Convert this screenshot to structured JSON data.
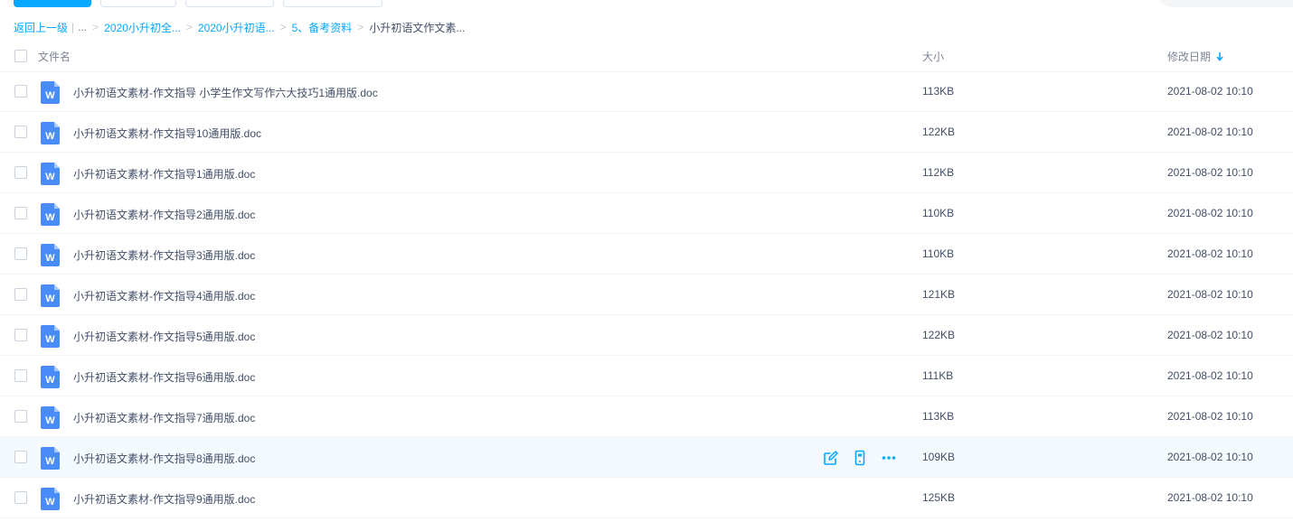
{
  "colors": {
    "accent": "#06a7ff",
    "doc_icon": "#4a8cf7",
    "text": "#424e67",
    "muted": "#7d8596",
    "row_hover": "#f5fafe"
  },
  "breadcrumb": {
    "back": "返回上一级",
    "separator": "|",
    "ellipsis": "...",
    "items": [
      "2020小升初全...",
      "2020小升初语...",
      "5、备考资料"
    ],
    "current": "小升初语文作文素..."
  },
  "table": {
    "headers": {
      "name": "文件名",
      "size": "大小",
      "date": "修改日期",
      "sort_icon": "arrow-down-icon"
    },
    "rows": [
      {
        "name": "小升初语文素材-作文指导 小学生作文写作六大技巧1通用版.doc",
        "size": "113KB",
        "date": "2021-08-02 10:10",
        "icon": "word-doc-icon"
      },
      {
        "name": "小升初语文素材-作文指导10通用版.doc",
        "size": "122KB",
        "date": "2021-08-02 10:10",
        "icon": "word-doc-icon"
      },
      {
        "name": "小升初语文素材-作文指导1通用版.doc",
        "size": "112KB",
        "date": "2021-08-02 10:10",
        "icon": "word-doc-icon"
      },
      {
        "name": "小升初语文素材-作文指导2通用版.doc",
        "size": "110KB",
        "date": "2021-08-02 10:10",
        "icon": "word-doc-icon"
      },
      {
        "name": "小升初语文素材-作文指导3通用版.doc",
        "size": "110KB",
        "date": "2021-08-02 10:10",
        "icon": "word-doc-icon"
      },
      {
        "name": "小升初语文素材-作文指导4通用版.doc",
        "size": "121KB",
        "date": "2021-08-02 10:10",
        "icon": "word-doc-icon"
      },
      {
        "name": "小升初语文素材-作文指导5通用版.doc",
        "size": "122KB",
        "date": "2021-08-02 10:10",
        "icon": "word-doc-icon"
      },
      {
        "name": "小升初语文素材-作文指导6通用版.doc",
        "size": "111KB",
        "date": "2021-08-02 10:10",
        "icon": "word-doc-icon"
      },
      {
        "name": "小升初语文素材-作文指导7通用版.doc",
        "size": "113KB",
        "date": "2021-08-02 10:10",
        "icon": "word-doc-icon"
      },
      {
        "name": "小升初语文素材-作文指导8通用版.doc",
        "size": "109KB",
        "date": "2021-08-02 10:10",
        "icon": "word-doc-icon",
        "hovered": true,
        "actions": [
          "edit-icon",
          "phone-icon",
          "more-icon"
        ]
      },
      {
        "name": "小升初语文素材-作文指导9通用版.doc",
        "size": "125KB",
        "date": "2021-08-02 10:10",
        "icon": "word-doc-icon"
      }
    ]
  }
}
